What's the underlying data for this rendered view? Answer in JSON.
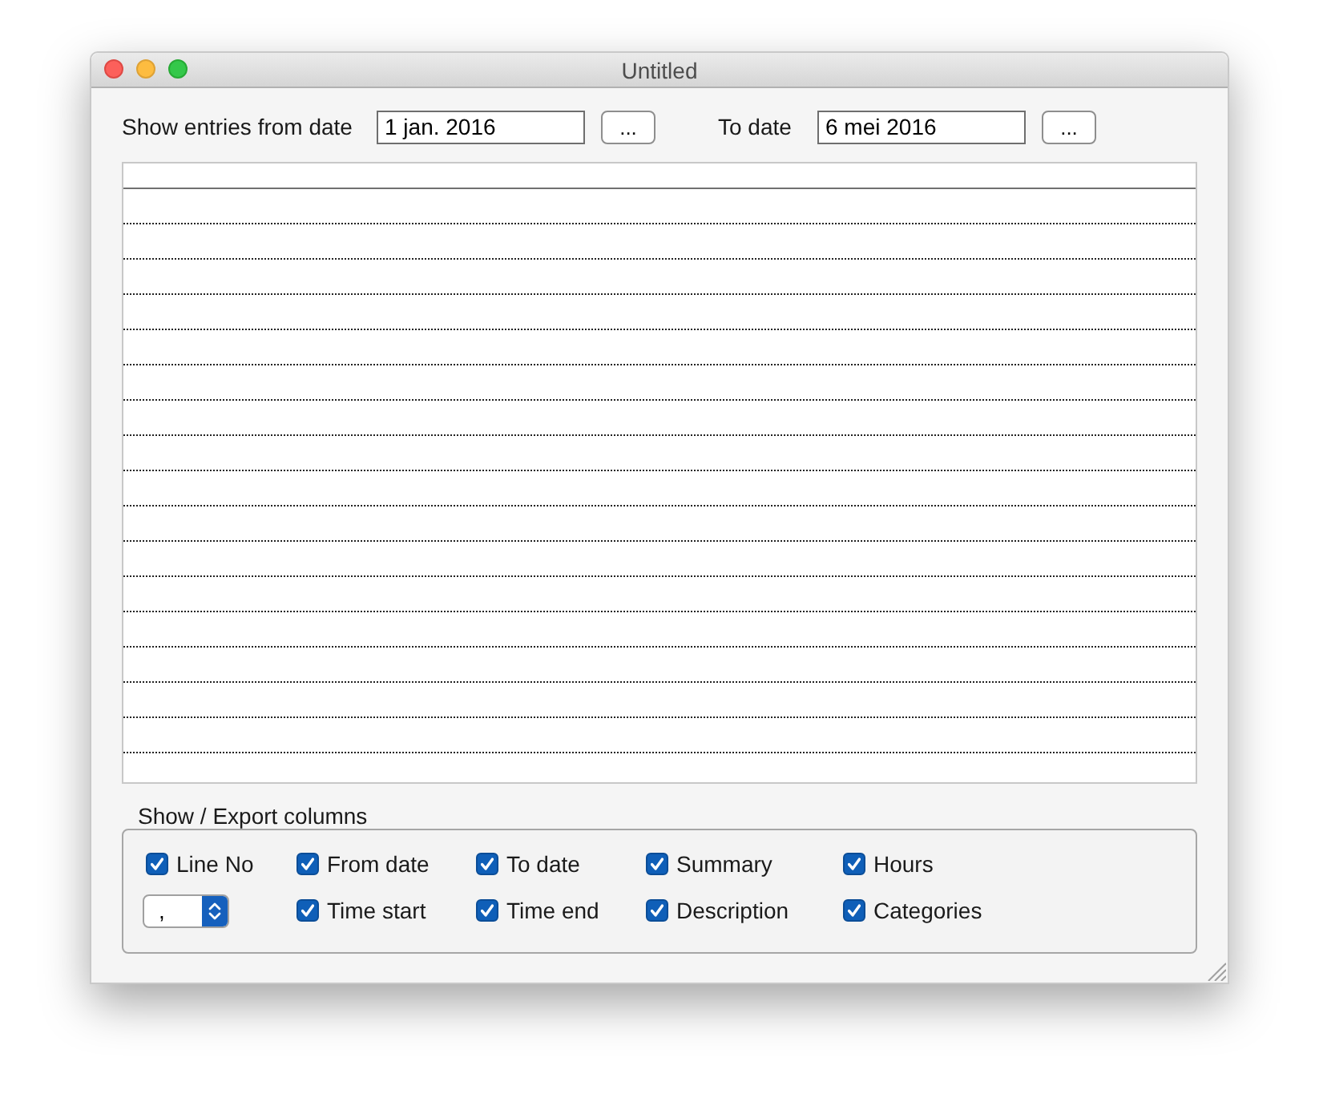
{
  "window": {
    "title": "Untitled"
  },
  "filter": {
    "from_label": "Show entries from date",
    "from_value": "1 jan. 2016",
    "from_button": "...",
    "to_label": "To date",
    "to_value": "6 mei 2016",
    "to_button": "..."
  },
  "columns_group": {
    "title": "Show / Export columns",
    "separator_select": {
      "value": ","
    },
    "checkboxes": [
      {
        "label": "Line No",
        "checked": true
      },
      {
        "label": "From date",
        "checked": true
      },
      {
        "label": "To date",
        "checked": true
      },
      {
        "label": "Summary",
        "checked": true
      },
      {
        "label": "Hours",
        "checked": true
      },
      {
        "label": "Time start",
        "checked": true
      },
      {
        "label": "Time end",
        "checked": true
      },
      {
        "label": "Description",
        "checked": true
      },
      {
        "label": "Categories",
        "checked": true
      }
    ]
  }
}
